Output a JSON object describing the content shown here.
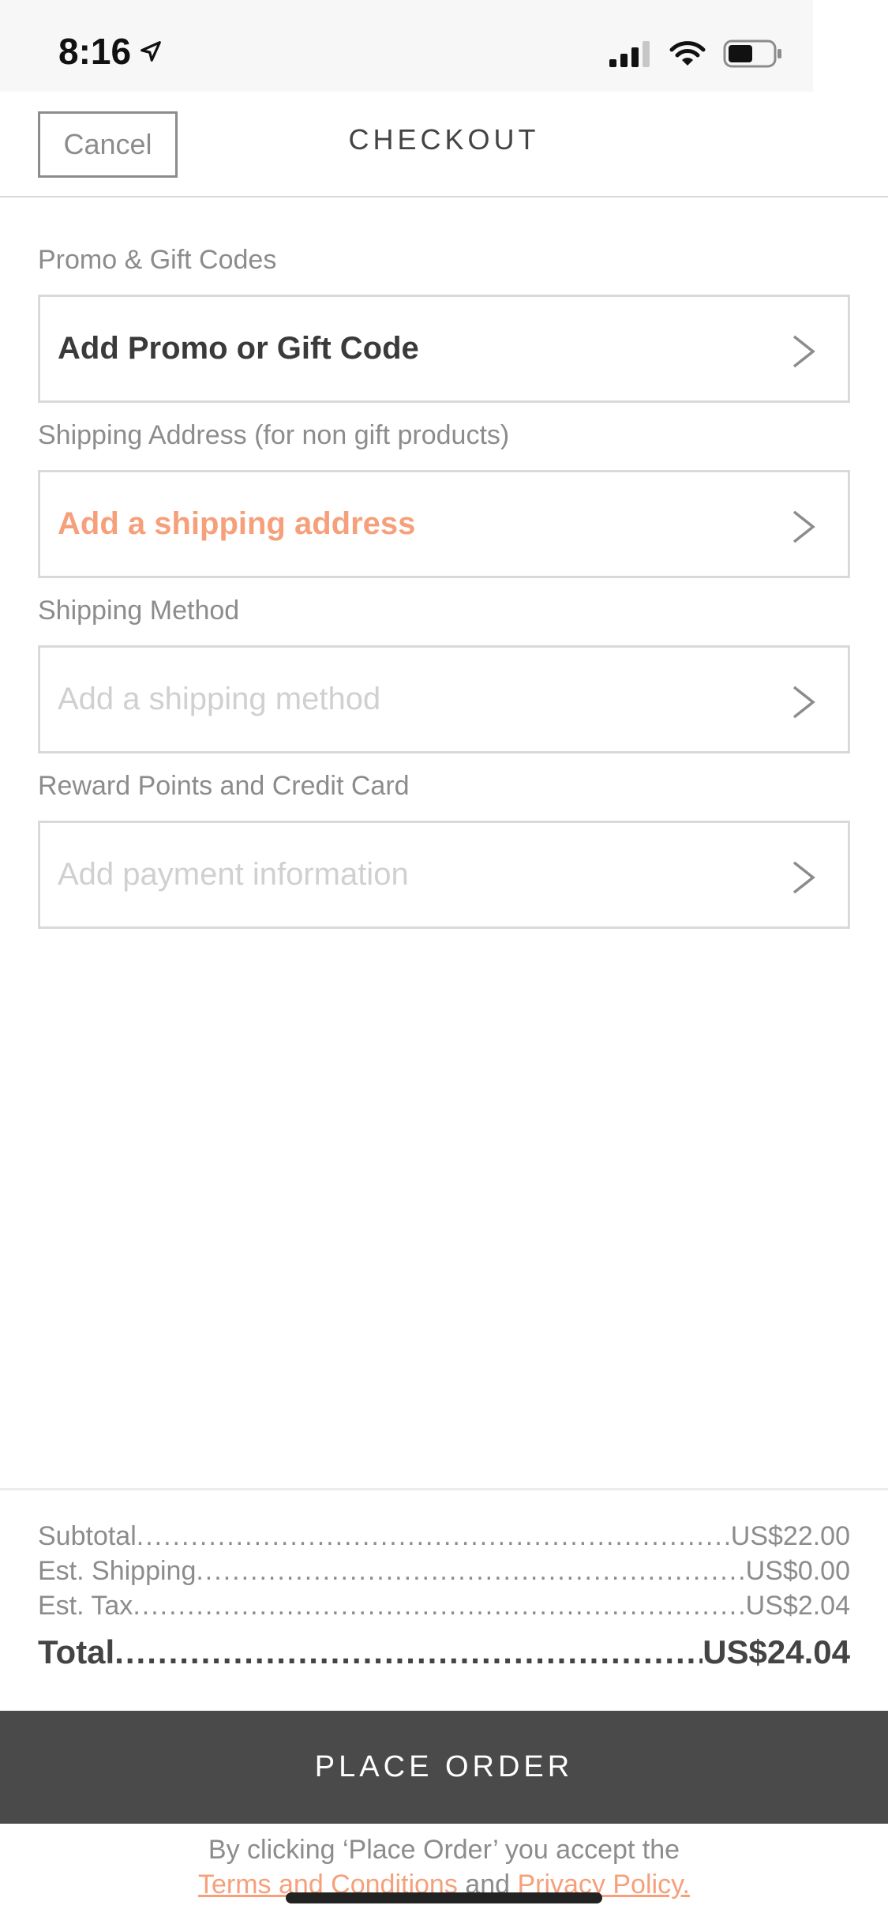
{
  "status_bar": {
    "time": "8:16",
    "icons": [
      "location-arrow-icon",
      "cellular-signal-icon",
      "wifi-icon",
      "battery-icon"
    ]
  },
  "header": {
    "cancel_label": "Cancel",
    "title": "CHECKOUT"
  },
  "sections": {
    "promo": {
      "label": "Promo & Gift Codes",
      "value": "Add Promo or Gift Code"
    },
    "shipping_address": {
      "label": "Shipping Address  (for non gift products)",
      "value": "Add a shipping address"
    },
    "shipping_method": {
      "label": "Shipping Method",
      "placeholder": "Add a shipping method"
    },
    "payment": {
      "label": "Reward Points and Credit Card",
      "placeholder": "Add payment information"
    }
  },
  "summary": {
    "subtotal_label": "Subtotal",
    "subtotal_value": "US$22.00",
    "shipping_label": "Est. Shipping",
    "shipping_value": "US$0.00",
    "tax_label": "Est. Tax",
    "tax_value": "US$2.04",
    "total_label": "Total",
    "total_value": "US$24.04"
  },
  "place_order_label": "PLACE ORDER",
  "legal": {
    "prefix": "By clicking ‘Place Order’ you accept the",
    "terms_link": "Terms and Conditions",
    "and": "and",
    "privacy_link": "Privacy Policy."
  },
  "colors": {
    "accent": "#f6a07b",
    "button_bg": "#4a4a4a",
    "border": "#d9d9d9"
  }
}
